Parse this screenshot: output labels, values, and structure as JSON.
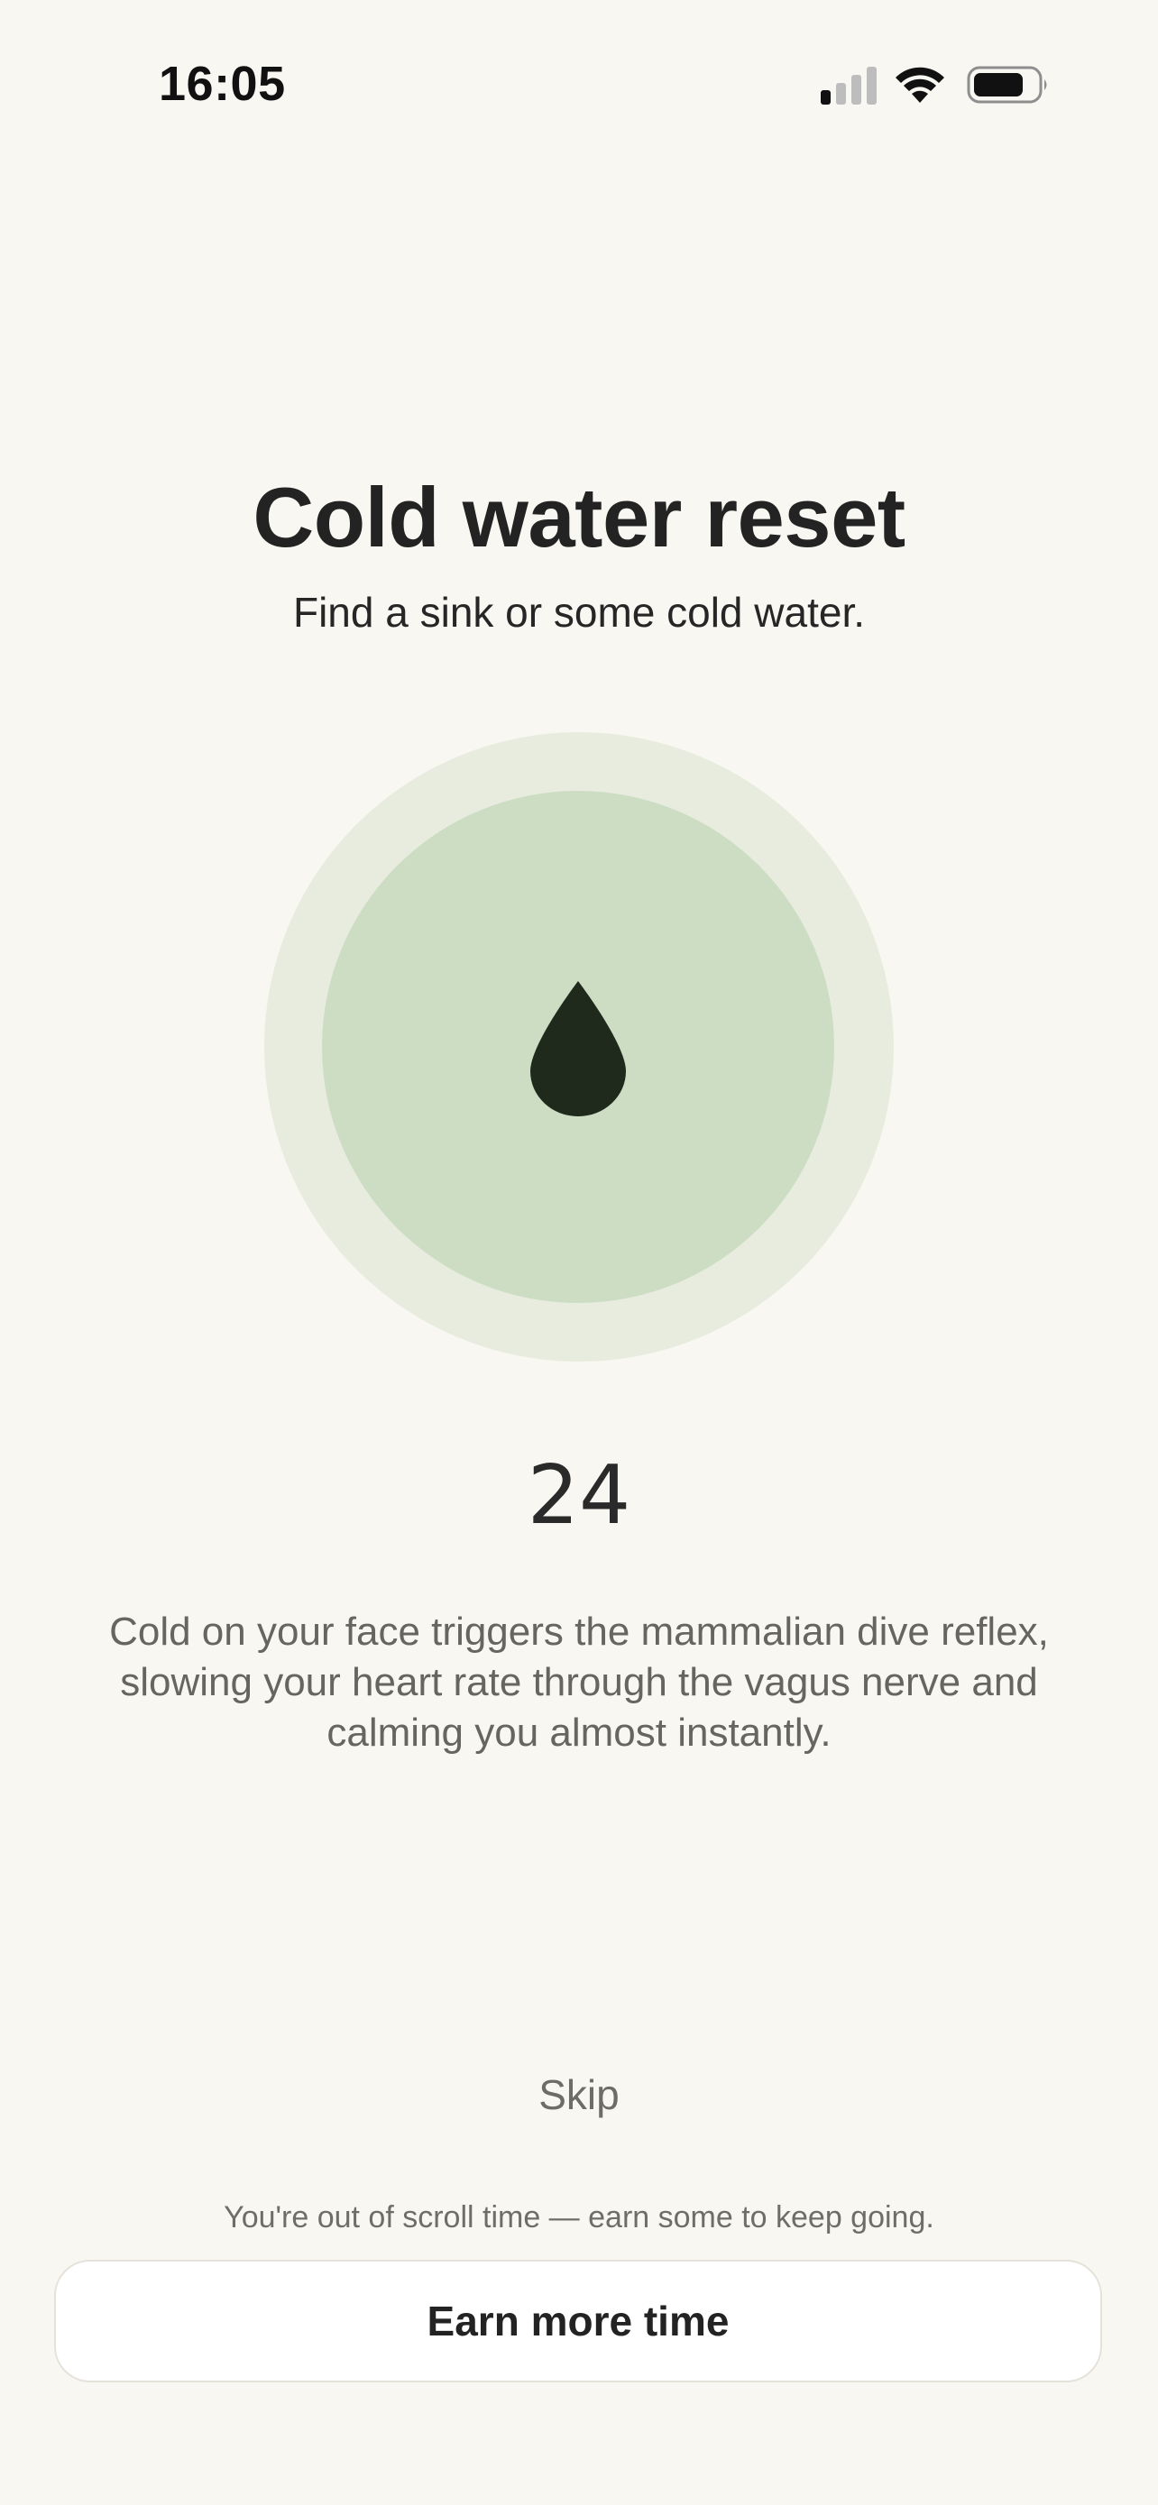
{
  "status_bar": {
    "time": "16:05",
    "signal_icon": "cellular-signal-icon",
    "wifi_icon": "wifi-icon",
    "battery_icon": "battery-icon"
  },
  "screen": {
    "title": "Cold water reset",
    "subtitle": "Find a sink or some cold water.",
    "icon": "water-drop-icon",
    "counter": "24",
    "description": "Cold on your face triggers the mammalian dive reflex, slowing your heart rate through the vagus nerve and calming you almost instantly.",
    "skip_label": "Skip"
  },
  "footer": {
    "notice": "You're out of scroll time — earn some to keep going.",
    "button_label": "Earn more time"
  },
  "colors": {
    "background": "#F9F7F1",
    "outer_circle": "#E8ECDF",
    "inner_circle": "#CCDDC4",
    "drop": "#1F2A1C"
  }
}
